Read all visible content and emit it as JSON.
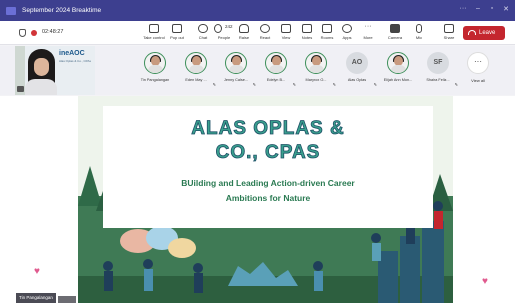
{
  "window": {
    "title": "September 2024 Breaktime",
    "controls": [
      "minimize-icon",
      "maximize-icon",
      "close-icon"
    ]
  },
  "toolbar": {
    "timer": "02:48:27",
    "buttons": [
      {
        "label": "Take control",
        "icon": "take-control-icon"
      },
      {
        "label": "Pop out",
        "icon": "pop-out-icon"
      },
      {
        "label": "Chat",
        "icon": "chat-icon"
      },
      {
        "label": "People",
        "icon": "people-icon",
        "count": "242"
      },
      {
        "label": "Raise",
        "icon": "raise-hand-icon"
      },
      {
        "label": "React",
        "icon": "react-icon"
      },
      {
        "label": "View",
        "icon": "view-icon"
      },
      {
        "label": "Notes",
        "icon": "notes-icon"
      },
      {
        "label": "Rooms",
        "icon": "rooms-icon"
      },
      {
        "label": "Apps",
        "icon": "apps-icon"
      },
      {
        "label": "More",
        "icon": "more-icon"
      },
      {
        "label": "Camera",
        "icon": "camera-icon"
      },
      {
        "label": "Mic",
        "icon": "mic-icon"
      },
      {
        "label": "Share",
        "icon": "share-icon"
      }
    ],
    "leave_label": "Leave"
  },
  "self_video": {
    "brand": "ineAOC",
    "brand_sub": "Alas Oplas & Co., CPAs"
  },
  "participants": [
    {
      "name": "Tin Pangalangan"
    },
    {
      "name": "Eden May ..."
    },
    {
      "name": "Jenny Calse..."
    },
    {
      "name": "Edelyn B..."
    },
    {
      "name": "Maryrox O..."
    },
    {
      "name": "Alas Oplas",
      "initials": "AO"
    },
    {
      "name": "Elijah Ann Mon..."
    },
    {
      "name": "Shaira Feliz...",
      "initials": "SF"
    }
  ],
  "view_all_label": "View all",
  "presenter_label": "Tin Pangalangan",
  "slide": {
    "title_line1": "ALAS OPLAS &",
    "title_line2": "CO., CPAS",
    "subtitle_line1": "BUilding and Leading Action-driven Career",
    "subtitle_line2": "Ambitions for Nature"
  },
  "colors": {
    "titlebar": "#3d3f8f",
    "leave": "#c4262e",
    "slide_title": "#3aa08e",
    "slide_green": "#3f7a55"
  }
}
